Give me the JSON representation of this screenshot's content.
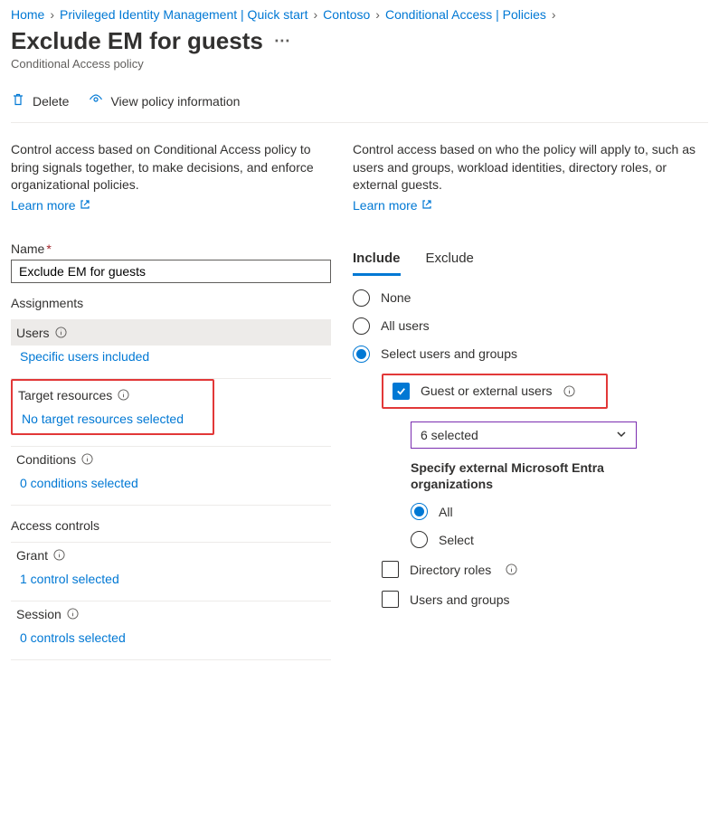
{
  "breadcrumb": {
    "items": [
      {
        "label": "Home"
      },
      {
        "label": "Privileged Identity Management | Quick start"
      },
      {
        "label": "Contoso"
      },
      {
        "label": "Conditional Access | Policies"
      }
    ]
  },
  "header": {
    "title": "Exclude EM for guests",
    "subtitle": "Conditional Access policy"
  },
  "toolbar": {
    "delete_label": "Delete",
    "view_info_label": "View policy information"
  },
  "left": {
    "description": "Control access based on Conditional Access policy to bring signals together, to make decisions, and enforce organizational policies.",
    "learn_more": "Learn more",
    "name_label": "Name",
    "name_value": "Exclude EM for guests",
    "assignments_title": "Assignments",
    "users": {
      "label": "Users",
      "value": "Specific users included"
    },
    "target_resources": {
      "label": "Target resources",
      "value": "No target resources selected"
    },
    "conditions": {
      "label": "Conditions",
      "value": "0 conditions selected"
    },
    "access_controls_title": "Access controls",
    "grant": {
      "label": "Grant",
      "value": "1 control selected"
    },
    "session": {
      "label": "Session",
      "value": "0 controls selected"
    }
  },
  "right": {
    "description": "Control access based on who the policy will apply to, such as users and groups, workload identities, directory roles, or external guests.",
    "learn_more": "Learn more",
    "tabs": {
      "include": "Include",
      "exclude": "Exclude"
    },
    "options": {
      "none": "None",
      "all_users": "All users",
      "select_users": "Select users and groups"
    },
    "guest_checkbox": "Guest or external users",
    "dropdown_value": "6 selected",
    "orgs_subhead": "Specify external Microsoft Entra organizations",
    "orgs_all": "All",
    "orgs_select": "Select",
    "directory_roles": "Directory roles",
    "users_groups": "Users and groups"
  }
}
